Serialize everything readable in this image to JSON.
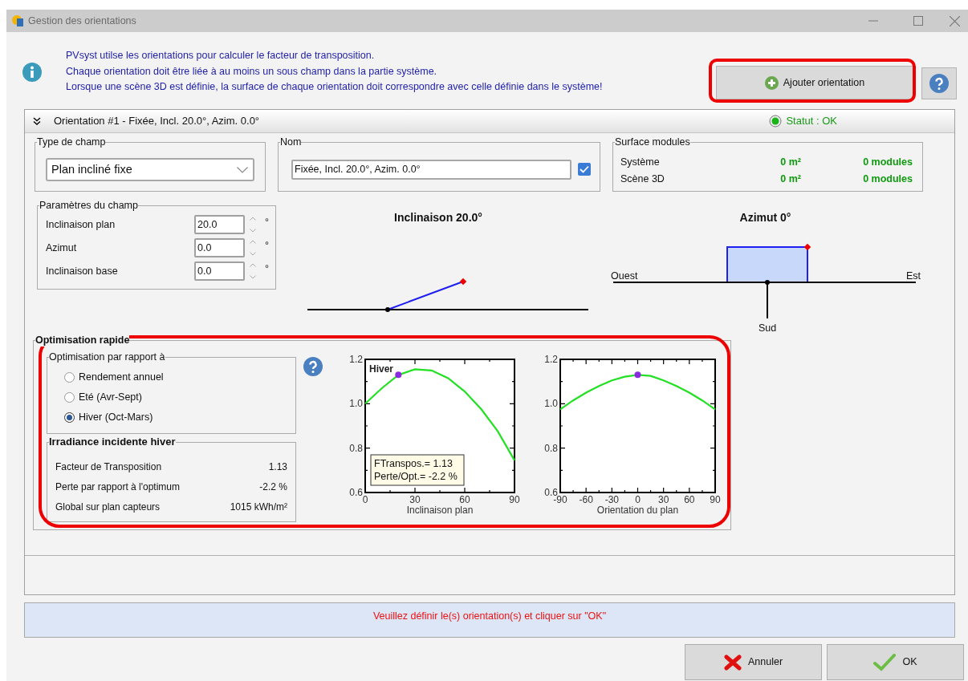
{
  "window": {
    "title": "Gestion des orientations"
  },
  "info": {
    "lines": [
      "PVsyst utilse les orientations pour calculer le facteur de transposition.",
      "Chaque orientation doit être liée à au moins un sous champ dans la partie système.",
      "Lorsque une scène 3D est définie, la surface de chaque orientation doit correspondre avec celle définie dans le système!"
    ]
  },
  "add_button": {
    "label": "Ajouter orientation",
    "highlighted": true
  },
  "orientation": {
    "header": "Orientation #1 - Fixée, Incl. 20.0°, Azim. 0.0°",
    "expanded": true,
    "status": "Statut : OK",
    "ok": true,
    "field_type": {
      "label": "Type de champ",
      "value": "Plan incliné fixe"
    },
    "name": {
      "label": "Nom",
      "value": "Fixée, Incl. 20.0°, Azim. 0.0°",
      "checked": true
    },
    "surface": {
      "label": "Surface modules",
      "rows": [
        {
          "name": "Système",
          "area": "0 m²",
          "modules": "0 modules"
        },
        {
          "name": "Scène 3D",
          "area": "0 m²",
          "modules": "0 modules"
        }
      ]
    },
    "parameters": {
      "label": "Paramètres du champ",
      "rows": [
        {
          "name": "Inclinaison plan",
          "value": "20.0",
          "unit": "°"
        },
        {
          "name": "Azimut",
          "value": "0.0",
          "unit": "°"
        },
        {
          "name": "Inclinaison base",
          "value": "0.0",
          "unit": "°"
        }
      ]
    },
    "tilt_diagram": {
      "title": "Inclinaison 20.0°"
    },
    "azimuth_diagram": {
      "title": "Azimut 0°",
      "west": "Ouest",
      "east": "Est",
      "south": "Sud"
    },
    "optimisation": {
      "label": "Optimisation rapide",
      "highlighted": true,
      "criterion": {
        "label": "Optimisation par rapport à",
        "options": [
          {
            "label": "Rendement annuel",
            "selected": false
          },
          {
            "label": "Eté (Avr-Sept)",
            "selected": false
          },
          {
            "label": "Hiver (Oct-Mars)",
            "selected": true
          }
        ]
      },
      "irradiance": {
        "label": "Irradiance incidente hiver",
        "rows": [
          {
            "name": "Facteur de Transposition",
            "value": "1.13"
          },
          {
            "name": "Perte par rapport à l'optimum",
            "value": "-2.2 %"
          },
          {
            "name": "Global sur plan capteurs",
            "value": "1015 kWh/m²"
          }
        ]
      },
      "charts": [
        {
          "chart_data": {
            "type": "line",
            "xlabel": "Inclinaison plan",
            "x": [
              0,
              10,
              20,
              30,
              40,
              50,
              60,
              70,
              80,
              90
            ],
            "xlim": [
              0,
              90
            ],
            "ylim": [
              0.6,
              1.2
            ],
            "xticks": [
              0,
              30,
              60,
              90
            ],
            "yticks": [
              {
                "value": 0.6,
                "label": "0.6"
              },
              {
                "value": 0.8,
                "label": "0.8"
              },
              {
                "value": 1.0,
                "label": "1.0"
              },
              {
                "value": 1.2,
                "label": "1.2"
              }
            ],
            "series": [
              {
                "color": "#22e022",
                "marker": false,
                "values": [
                  1.0,
                  1.07,
                  1.13,
                  1.155,
                  1.15,
                  1.115,
                  1.055,
                  0.975,
                  0.875,
                  0.745
                ]
              },
              {
                "color": "#8a2be2",
                "marker": true,
                "values": [
                  null,
                  null,
                  1.13,
                  null,
                  null,
                  null,
                  null,
                  null,
                  null,
                  null
                ]
              }
            ],
            "annotations": [
              "Hiver",
              "FTranspos.= 1.13",
              "Perte/Opt.= -2.2 %"
            ]
          }
        },
        {
          "chart_data": {
            "type": "line",
            "xlabel": "Orientation du plan",
            "x": [
              -90,
              -75,
              -60,
              -45,
              -30,
              -15,
              0,
              15,
              30,
              45,
              60,
              75,
              90
            ],
            "xlim": [
              -90,
              90
            ],
            "ylim": [
              0.6,
              1.2
            ],
            "xticks": [
              -90,
              -60,
              -30,
              0,
              30,
              60,
              90
            ],
            "yticks": [
              {
                "value": 0.6,
                "label": "0.6"
              },
              {
                "value": 0.8,
                "label": "0.8"
              },
              {
                "value": 1.0,
                "label": "1.0"
              },
              {
                "value": 1.2,
                "label": "1.2"
              }
            ],
            "series": [
              {
                "color": "#22e022",
                "marker": false,
                "values": [
                  0.975,
                  1.015,
                  1.05,
                  1.08,
                  1.105,
                  1.122,
                  1.13,
                  1.125,
                  1.105,
                  1.08,
                  1.05,
                  1.015,
                  0.975
                ]
              },
              {
                "color": "#8a2be2",
                "marker": true,
                "values": [
                  null,
                  null,
                  null,
                  null,
                  null,
                  null,
                  1.13,
                  null,
                  null,
                  null,
                  null,
                  null,
                  null
                ]
              }
            ]
          }
        }
      ]
    }
  },
  "message": "Veuillez définir le(s) orientation(s) et cliquer sur \"OK\"",
  "buttons": [
    {
      "kind": "cancel",
      "label": "Annuler"
    },
    {
      "kind": "ok",
      "label": "OK"
    }
  ]
}
